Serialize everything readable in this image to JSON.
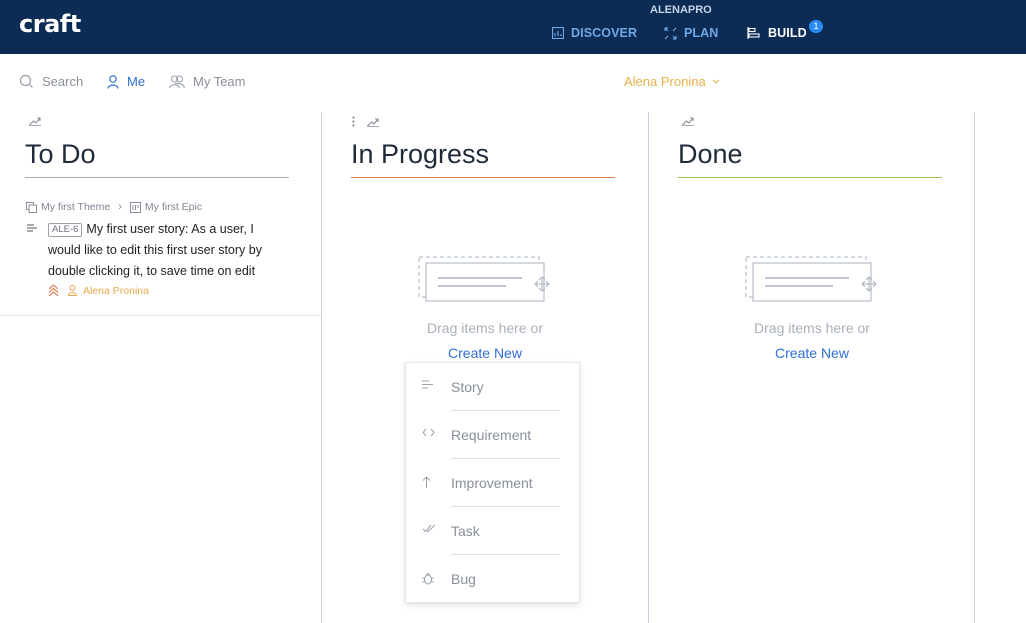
{
  "app": {
    "logo": "craft",
    "workspace": "ALENAPRO"
  },
  "nav": {
    "discover": "DISCOVER",
    "plan": "PLAN",
    "build": "BUILD",
    "build_badge": "1"
  },
  "filters": {
    "search": "Search",
    "me": "Me",
    "my_team": "My Team",
    "user": "Alena Pronina"
  },
  "columns": [
    {
      "title": "To Do",
      "accent": "#aab2bf"
    },
    {
      "title": "In Progress",
      "accent": "#d9814a"
    },
    {
      "title": "Done",
      "accent": "#9bc14a"
    }
  ],
  "card": {
    "theme": "My first Theme",
    "epic": "My first Epic",
    "id": "ALE-6",
    "text": "My first user story: As a user, I would like to edit this first user story by double clicking it, to save time on edit",
    "assignee": "Alena Pronina"
  },
  "empty": {
    "drag_text": "Drag items here or",
    "create_new": "Create New"
  },
  "dropdown": {
    "items": [
      {
        "label": "Story",
        "icon": "story-icon"
      },
      {
        "label": "Requirement",
        "icon": "code-icon"
      },
      {
        "label": "Improvement",
        "icon": "arrow-up-icon"
      },
      {
        "label": "Task",
        "icon": "double-check-icon"
      },
      {
        "label": "Bug",
        "icon": "bug-icon"
      }
    ]
  },
  "colors": {
    "topbar": "#0c2b55",
    "link_blue": "#2f6fd6",
    "user_orange": "#e8b04a"
  }
}
